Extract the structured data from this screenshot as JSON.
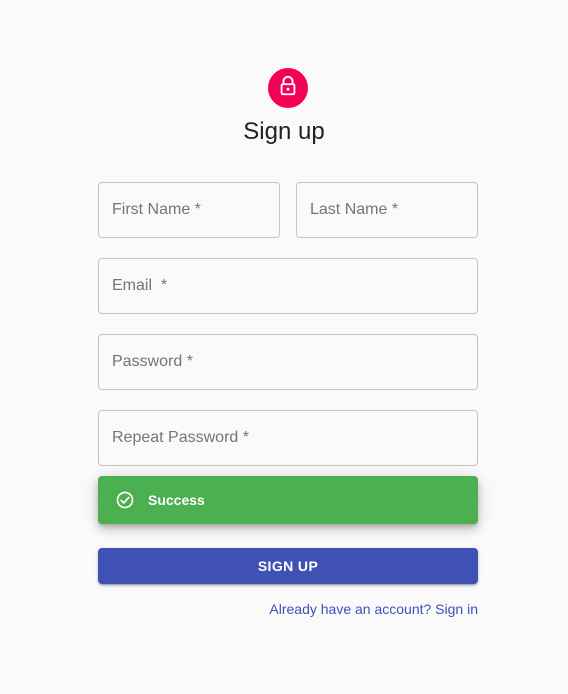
{
  "colors": {
    "avatar_bg": "#f50057",
    "success_bg": "#4caf50",
    "primary": "#3f51b5",
    "link": "#3f51b5"
  },
  "header": {
    "avatar_icon": "lock-icon",
    "title": "Sign up"
  },
  "form": {
    "first_name": {
      "placeholder": "First Name *",
      "value": ""
    },
    "last_name": {
      "placeholder": "Last Name *",
      "value": ""
    },
    "email": {
      "placeholder": "Email  *",
      "value": ""
    },
    "password": {
      "placeholder": "Password *",
      "value": ""
    },
    "repeat_password": {
      "placeholder": "Repeat Password *",
      "value": ""
    }
  },
  "alert": {
    "icon": "check-circle-icon",
    "message": "Success"
  },
  "submit": {
    "label": "SIGN UP"
  },
  "footer": {
    "signin_link": "Already have an account? Sign in"
  }
}
